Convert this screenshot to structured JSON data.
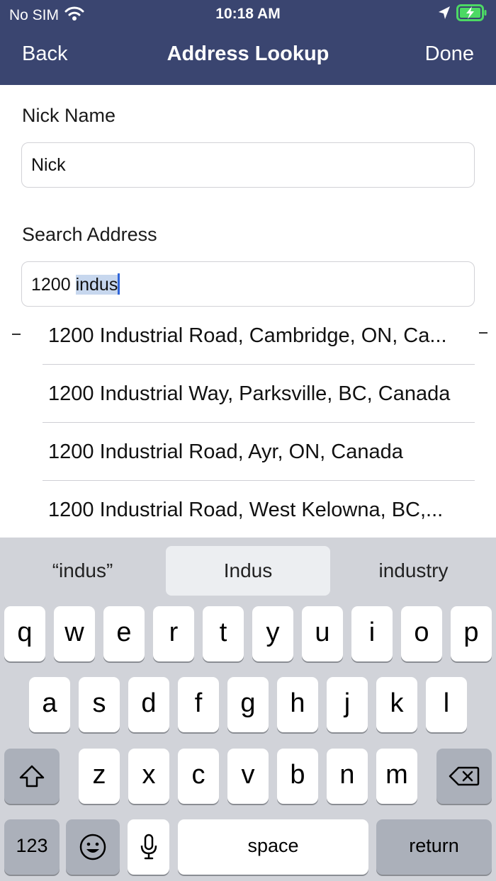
{
  "status_bar": {
    "carrier": "No SIM",
    "time": "10:18 AM"
  },
  "nav": {
    "back_label": "Back",
    "title": "Address Lookup",
    "done_label": "Done"
  },
  "form": {
    "nickname_label": "Nick Name",
    "nickname_value": "Nick",
    "search_label": "Search Address",
    "search_value_prefix": "1200 ",
    "search_value_selected": "indus"
  },
  "suggestions": [
    "1200 Industrial Road, Cambridge, ON, Ca...",
    "1200 Industrial Way, Parksville, BC, Canada",
    "1200 Industrial Road, Ayr, ON, Canada",
    "1200 Industrial Road, West Kelowna, BC,..."
  ],
  "keyboard": {
    "predictions": [
      "“indus”",
      "Indus",
      "industry"
    ],
    "row1": [
      "q",
      "w",
      "e",
      "r",
      "t",
      "y",
      "u",
      "i",
      "o",
      "p"
    ],
    "row2": [
      "a",
      "s",
      "d",
      "f",
      "g",
      "h",
      "j",
      "k",
      "l"
    ],
    "row3": [
      "z",
      "x",
      "c",
      "v",
      "b",
      "n",
      "m"
    ],
    "numbers_label": "123",
    "space_label": "space",
    "return_label": "return"
  },
  "colors": {
    "nav_bar": "#3a4570",
    "keyboard_bg": "#d1d3d9",
    "selection": "#c7d7ee",
    "caret": "#2f64d8",
    "battery": "#4cd964"
  },
  "icons": {
    "wifi": "wifi-icon",
    "location": "location-arrow-icon",
    "battery": "battery-charging-icon",
    "shift": "shift-icon",
    "delete": "delete-icon",
    "emoji": "emoji-icon",
    "mic": "microphone-icon"
  }
}
